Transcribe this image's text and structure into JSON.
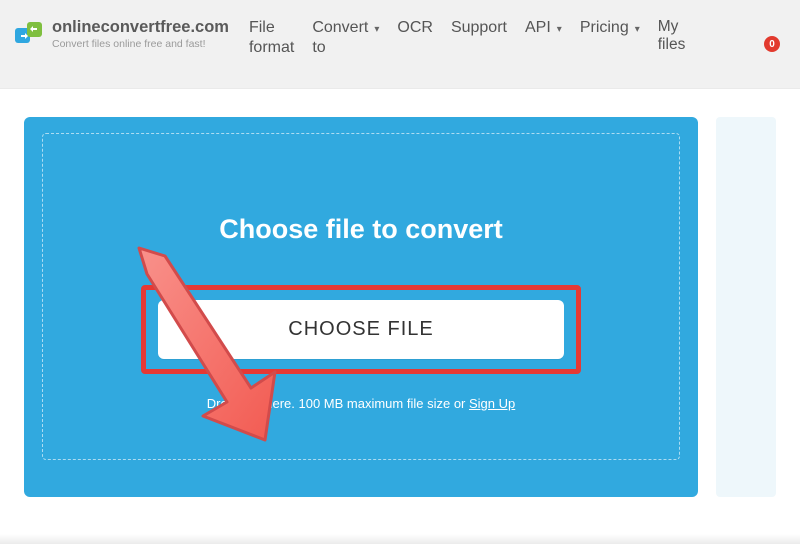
{
  "brand": {
    "title": "onlineconvertfree.com",
    "tagline": "Convert files online free and fast!"
  },
  "nav": {
    "file_format": "File format",
    "convert_to": "Convert to",
    "ocr": "OCR",
    "support": "Support",
    "api": "API",
    "pricing": "Pricing",
    "my_files": "My files"
  },
  "badge_count": "0",
  "panel": {
    "heading": "Choose file to convert",
    "button": "CHOOSE FILE",
    "drop_prefix": "Drop files here. 100 MB maximum file size or ",
    "signup": "Sign Up"
  },
  "colors": {
    "panel_bg": "#31a9df",
    "highlight_red": "#e53935",
    "badge_red": "#e23a2e",
    "arrow_fill": "#f67a73",
    "arrow_stroke": "#d24b4b"
  }
}
